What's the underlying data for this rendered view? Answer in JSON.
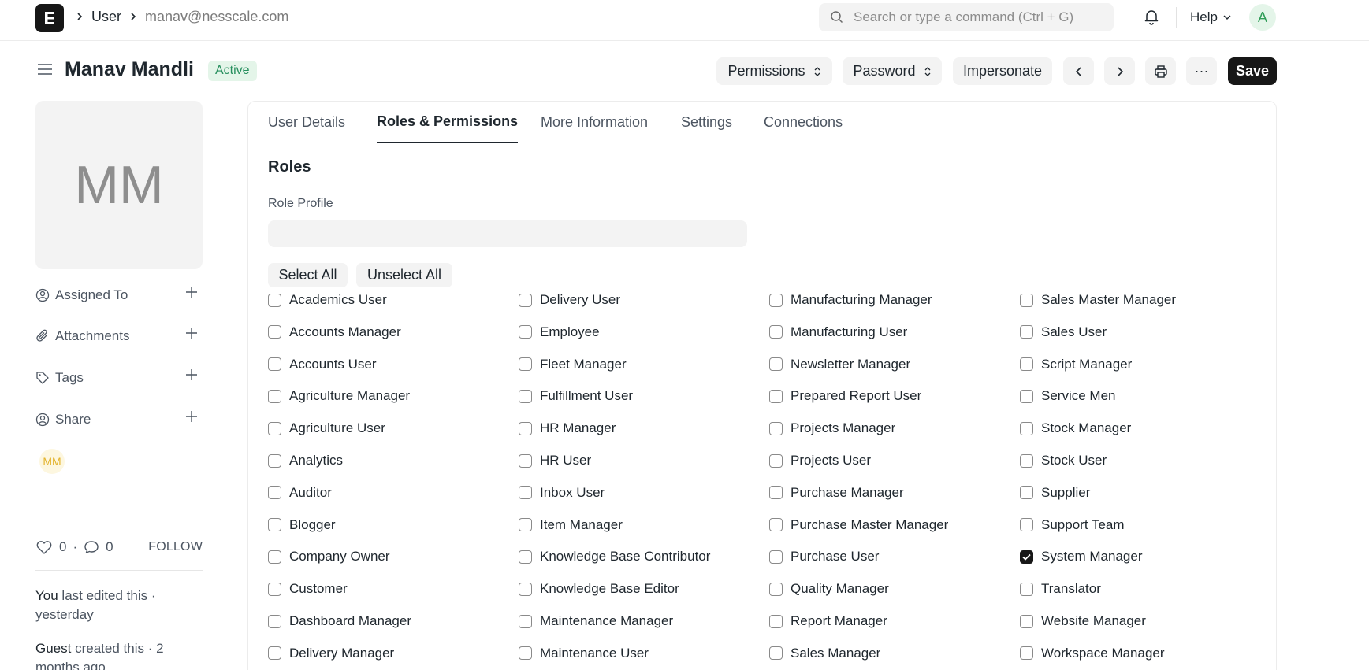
{
  "navbar": {
    "logo_letter": "E",
    "breadcrumbs": [
      "User",
      "manav@nesscale.com"
    ],
    "search_placeholder": "Search or type a command (Ctrl + G)",
    "help_label": "Help",
    "avatar_initial": "A"
  },
  "header": {
    "title": "Manav Mandli",
    "status": "Active",
    "buttons": {
      "permissions": "Permissions",
      "password": "Password",
      "impersonate": "Impersonate",
      "more": "···",
      "save": "Save"
    }
  },
  "sidebar": {
    "initials": "MM",
    "items": [
      {
        "label": "Assigned To",
        "icon": "user-assign-icon"
      },
      {
        "label": "Attachments",
        "icon": "paperclip-icon"
      },
      {
        "label": "Tags",
        "icon": "tag-icon"
      },
      {
        "label": "Share",
        "icon": "share-user-icon"
      }
    ],
    "shared_avatar": "MM",
    "likes": "0",
    "dot": "·",
    "comments": "0",
    "follow": "FOLLOW",
    "activity": [
      {
        "actor": "You",
        "text": "last edited this · yesterday"
      },
      {
        "actor": "Guest",
        "text": "created this · 2 months ago"
      }
    ]
  },
  "tabs": [
    "User Details",
    "Roles & Permissions",
    "More Information",
    "Settings",
    "Connections"
  ],
  "active_tab": "Roles & Permissions",
  "roles_section": {
    "title": "Roles",
    "role_profile_label": "Role Profile",
    "role_profile_value": "",
    "select_all": "Select All",
    "unselect_all": "Unselect All",
    "columns": [
      [
        {
          "label": "Academics User",
          "checked": false
        },
        {
          "label": "Accounts Manager",
          "checked": false
        },
        {
          "label": "Accounts User",
          "checked": false
        },
        {
          "label": "Agriculture Manager",
          "checked": false
        },
        {
          "label": "Agriculture User",
          "checked": false
        },
        {
          "label": "Analytics",
          "checked": false
        },
        {
          "label": "Auditor",
          "checked": false
        },
        {
          "label": "Blogger",
          "checked": false
        },
        {
          "label": "Company Owner",
          "checked": false
        },
        {
          "label": "Customer",
          "checked": false
        },
        {
          "label": "Dashboard Manager",
          "checked": false
        },
        {
          "label": "Delivery Manager",
          "checked": false
        }
      ],
      [
        {
          "label": "Delivery User",
          "checked": false,
          "hovered": true
        },
        {
          "label": "Employee",
          "checked": false
        },
        {
          "label": "Fleet Manager",
          "checked": false
        },
        {
          "label": "Fulfillment User",
          "checked": false
        },
        {
          "label": "HR Manager",
          "checked": false
        },
        {
          "label": "HR User",
          "checked": false
        },
        {
          "label": "Inbox User",
          "checked": false
        },
        {
          "label": "Item Manager",
          "checked": false
        },
        {
          "label": "Knowledge Base Contributor",
          "checked": false
        },
        {
          "label": "Knowledge Base Editor",
          "checked": false
        },
        {
          "label": "Maintenance Manager",
          "checked": false
        },
        {
          "label": "Maintenance User",
          "checked": false
        }
      ],
      [
        {
          "label": "Manufacturing Manager",
          "checked": false
        },
        {
          "label": "Manufacturing User",
          "checked": false
        },
        {
          "label": "Newsletter Manager",
          "checked": false
        },
        {
          "label": "Prepared Report User",
          "checked": false
        },
        {
          "label": "Projects Manager",
          "checked": false
        },
        {
          "label": "Projects User",
          "checked": false
        },
        {
          "label": "Purchase Manager",
          "checked": false
        },
        {
          "label": "Purchase Master Manager",
          "checked": false
        },
        {
          "label": "Purchase User",
          "checked": false
        },
        {
          "label": "Quality Manager",
          "checked": false
        },
        {
          "label": "Report Manager",
          "checked": false
        },
        {
          "label": "Sales Manager",
          "checked": false
        }
      ],
      [
        {
          "label": "Sales Master Manager",
          "checked": false
        },
        {
          "label": "Sales User",
          "checked": false
        },
        {
          "label": "Script Manager",
          "checked": false
        },
        {
          "label": "Service Men",
          "checked": false
        },
        {
          "label": "Stock Manager",
          "checked": false
        },
        {
          "label": "Stock User",
          "checked": false
        },
        {
          "label": "Supplier",
          "checked": false
        },
        {
          "label": "Support Team",
          "checked": false
        },
        {
          "label": "System Manager",
          "checked": true
        },
        {
          "label": "Translator",
          "checked": false
        },
        {
          "label": "Website Manager",
          "checked": false
        },
        {
          "label": "Workspace Manager",
          "checked": false
        }
      ]
    ]
  }
}
